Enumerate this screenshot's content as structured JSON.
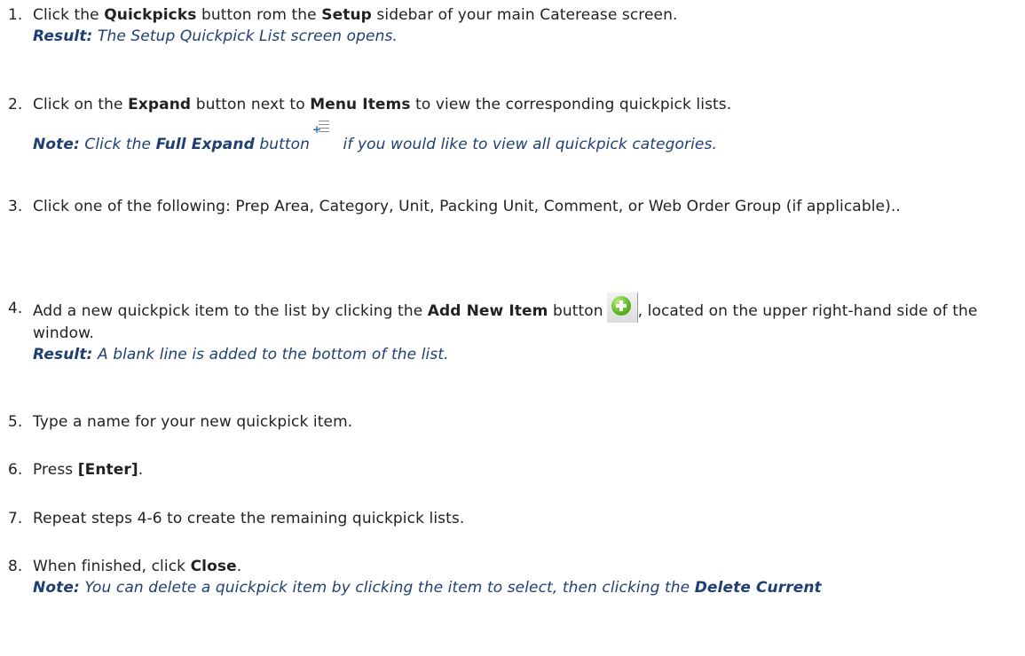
{
  "steps": [
    {
      "number": "1.",
      "t1": "Click the ",
      "b1": "Quickpicks",
      "t2": " button rom the ",
      "b2": "Setup",
      "t3": " sidebar of your main Caterease screen.",
      "result_label": "Result:",
      "result_text": " The Setup Quickpick List screen opens."
    },
    {
      "number": "2.",
      "t1": "Click on the ",
      "b1": "Expand",
      "t2": " button next to ",
      "b2": "Menu Items",
      "t3": " to view the corresponding quickpick lists.",
      "note_label": "Note:",
      "note_t1": " Click the ",
      "note_b1": "Full Expand",
      "note_t2": " button",
      "note_t3": " if you would like to view all quickpick categories."
    },
    {
      "number": "3.",
      "text": "Click one of the following: Prep Area, Category, Unit, Packing Unit, Comment, or Web Order Group (if applicable).."
    },
    {
      "number": "4.",
      "t1": "Add a new quickpick item to the list by clicking the ",
      "b1": "Add New Item",
      "t2": " button",
      "t3": ", located on the upper right-hand side of the window.",
      "result_label": "Result:",
      "result_text": " A blank line is added to the bottom of the list."
    },
    {
      "number": "5.",
      "text": "Type a name for your new quickpick item."
    },
    {
      "number": "6.",
      "t1": "Press ",
      "b1": "[Enter]",
      "t2": "."
    },
    {
      "number": "7.",
      "text": "Repeat steps 4-6 to create the remaining quickpick lists."
    },
    {
      "number": "8.",
      "t1": "When finished, click ",
      "b1": "Close",
      "t2": ".",
      "note_label": "Note:",
      "note_t1": " You can delete a quickpick item by clicking the item to select, then clicking the ",
      "note_b1": "Delete Current"
    }
  ],
  "icons": {
    "expand": "full-expand-icon",
    "add": "add-new-item-icon"
  }
}
